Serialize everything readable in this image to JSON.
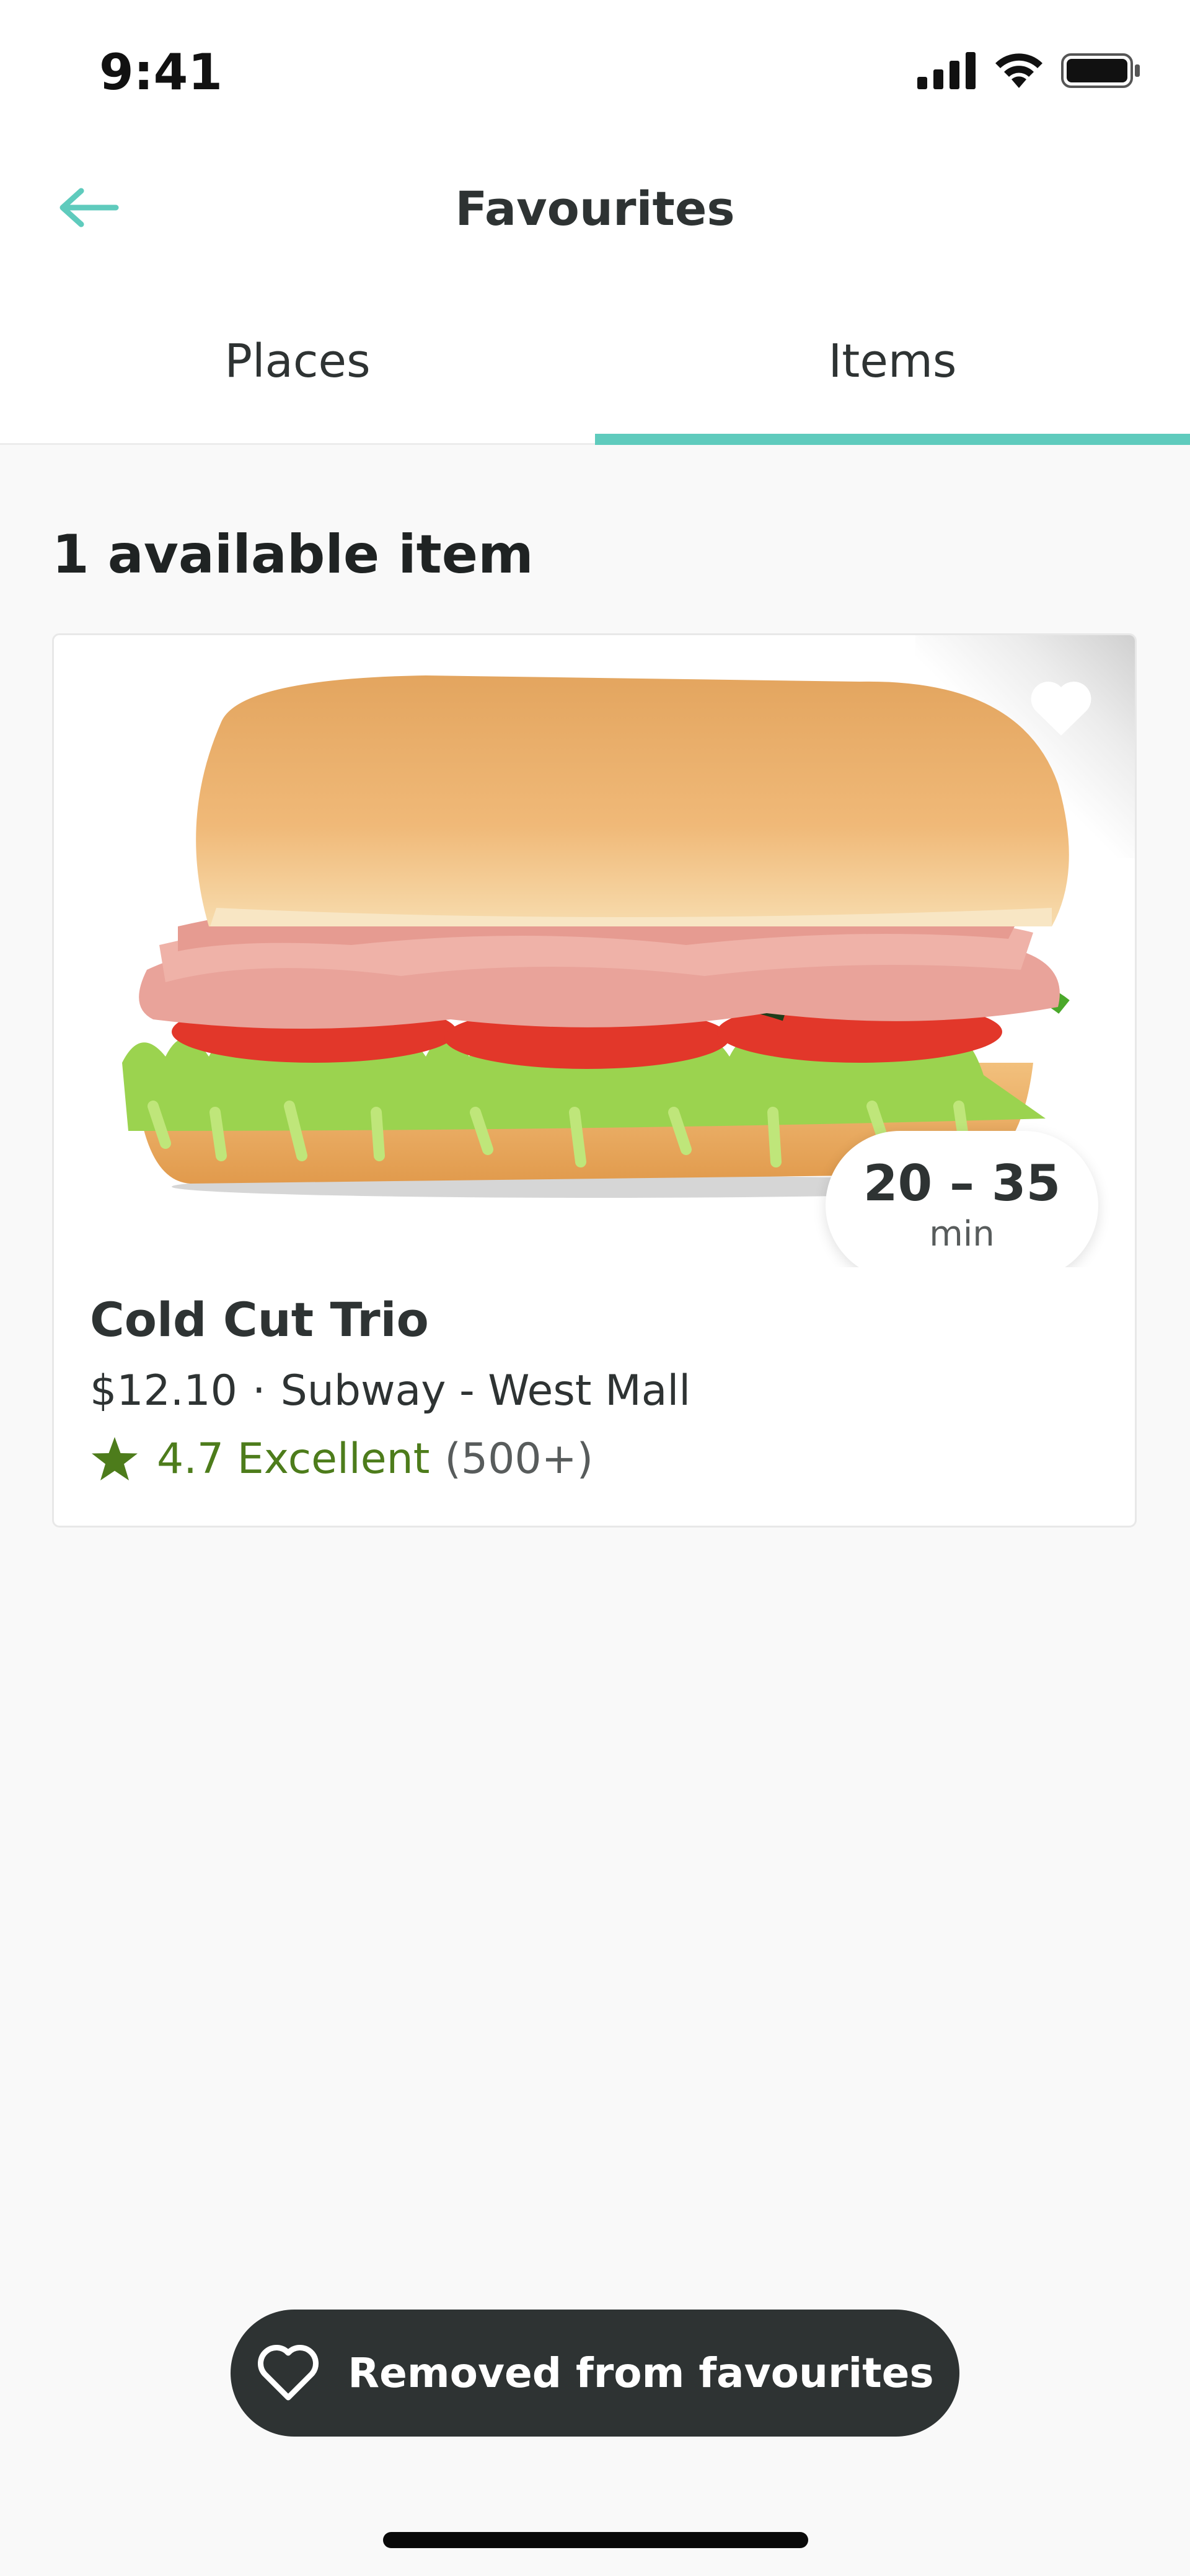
{
  "status_bar": {
    "time": "9:41",
    "icons": [
      "signal-icon",
      "wifi-icon",
      "battery-icon"
    ]
  },
  "header": {
    "title": "Favourites",
    "back_icon": "arrow-left-icon"
  },
  "tabs": [
    {
      "label": "Places",
      "selected": false
    },
    {
      "label": "Items",
      "selected": true
    }
  ],
  "section": {
    "heading": "1 available item"
  },
  "item": {
    "name": "Cold Cut Trio",
    "price": "$12.10",
    "separator": "·",
    "restaurant": "Subway - West Mall",
    "rating_score": "4.7 Excellent",
    "rating_count": "(500+)",
    "eta_range": "20 – 35",
    "eta_unit": "min",
    "favourite_icon": "heart-icon",
    "image_icon": "sandwich-image"
  },
  "toast": {
    "text": "Removed from favourites",
    "icon": "heart-outline-icon"
  },
  "colors": {
    "accent": "#5fcbbd",
    "rating_green": "#4d7c1b",
    "text": "#2e3333",
    "toast_bg": "#2e3333"
  }
}
